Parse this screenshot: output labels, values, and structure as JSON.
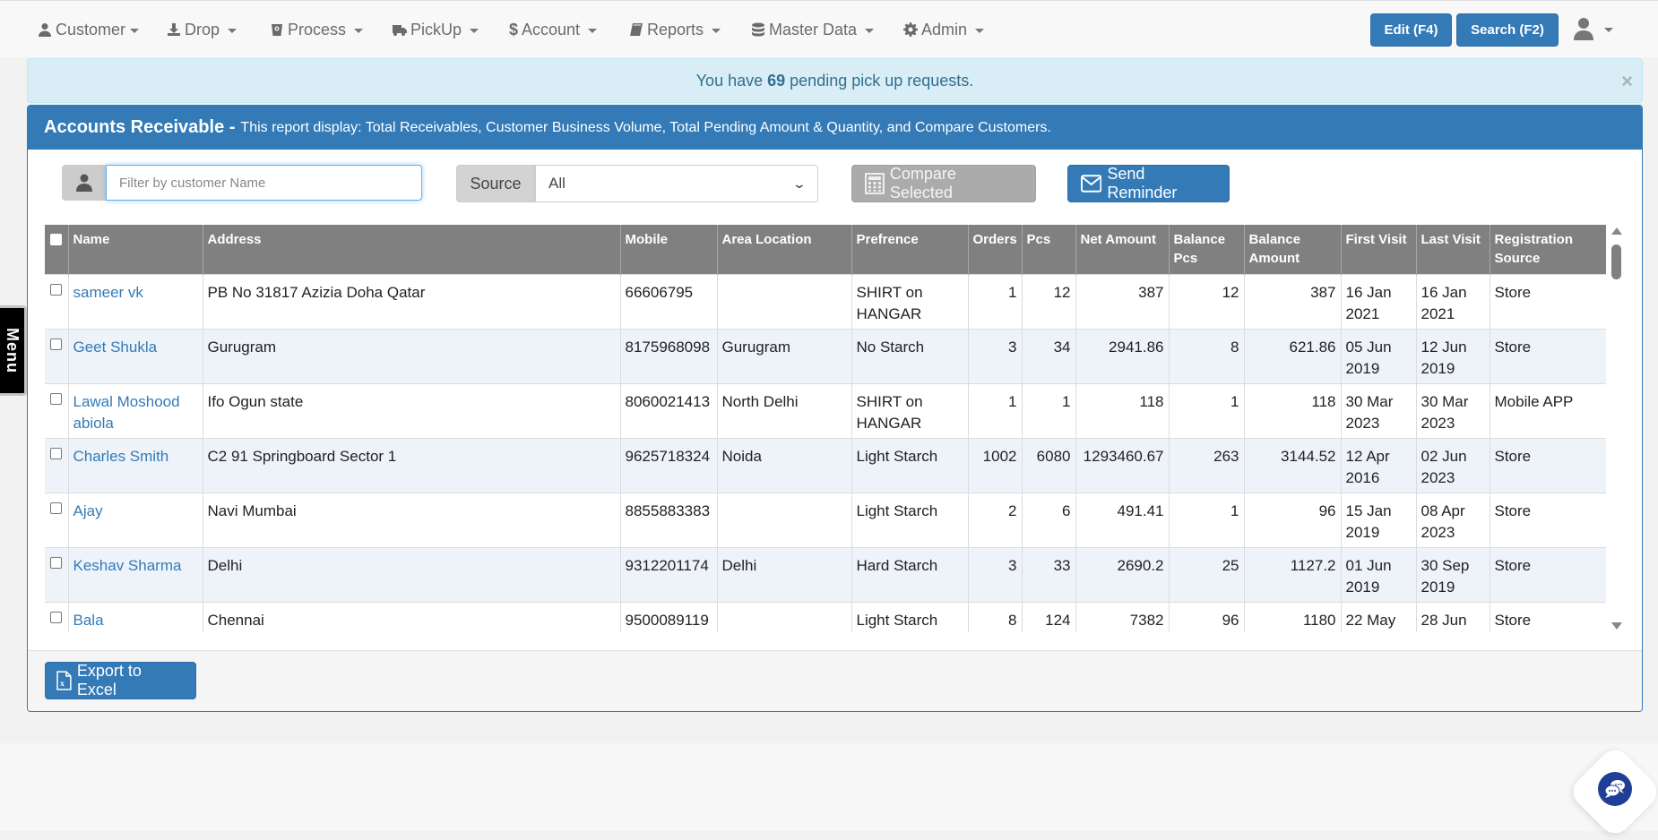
{
  "nav": {
    "items": [
      {
        "label": "Customer",
        "icon": "user-icon"
      },
      {
        "label": "Drop",
        "icon": "download-icon"
      },
      {
        "label": "Process",
        "icon": "bucket-icon"
      },
      {
        "label": "PickUp",
        "icon": "truck-icon"
      },
      {
        "label": "Account",
        "icon": "dollar-icon"
      },
      {
        "label": "Reports",
        "icon": "book-icon"
      },
      {
        "label": "Master Data",
        "icon": "database-icon"
      },
      {
        "label": "Admin",
        "icon": "gear-icon"
      }
    ],
    "edit_button": "Edit (F4)",
    "search_button": "Search (F2)"
  },
  "alert": {
    "prefix": "You have",
    "count": "69",
    "suffix": "pending pick up requests.",
    "close": "×"
  },
  "panel": {
    "title": "Accounts Receivable -",
    "description": "This report display: Total Receivables, Customer Business Volume, Total Pending Amount & Quantity, and Compare Customers."
  },
  "filters": {
    "customer_placeholder": "Filter by customer Name",
    "customer_value": "",
    "source_label": "Source",
    "source_value": "All",
    "compare_button": "Compare Selected",
    "reminder_button": "Send Reminder"
  },
  "table": {
    "headers": [
      "Name",
      "Address",
      "Mobile",
      "Area Location",
      "Prefrence",
      "Orders",
      "Pcs",
      "Net Amount",
      "Balance Pcs",
      "Balance Amount",
      "First Visit",
      "Last Visit",
      "Registration Source"
    ],
    "rows": [
      {
        "name": "sameer vk",
        "address": "PB No 31817 Azizia Doha Qatar",
        "mobile": "66606795",
        "area": "",
        "preference": "SHIRT on HANGAR",
        "orders": "1",
        "pcs": "12",
        "net_amount": "387",
        "balance_pcs": "12",
        "balance_amount": "387",
        "first_visit": "16 Jan 2021",
        "last_visit": "16 Jan 2021",
        "source": "Store"
      },
      {
        "name": "Geet Shukla",
        "address": "Gurugram",
        "mobile": "8175968098",
        "area": "Gurugram",
        "preference": "No Starch",
        "orders": "3",
        "pcs": "34",
        "net_amount": "2941.86",
        "balance_pcs": "8",
        "balance_amount": "621.86",
        "first_visit": "05 Jun 2019",
        "last_visit": "12 Jun 2019",
        "source": "Store"
      },
      {
        "name": "Lawal Moshood abiola",
        "address": "Ifo Ogun state",
        "mobile": "8060021413",
        "area": "North Delhi",
        "preference": "SHIRT on HANGAR",
        "orders": "1",
        "pcs": "1",
        "net_amount": "118",
        "balance_pcs": "1",
        "balance_amount": "118",
        "first_visit": "30 Mar 2023",
        "last_visit": "30 Mar 2023",
        "source": "Mobile APP"
      },
      {
        "name": "Charles Smith",
        "address": "C2 91 Springboard Sector 1",
        "mobile": "9625718324",
        "area": "Noida",
        "preference": "Light Starch",
        "orders": "1002",
        "pcs": "6080",
        "net_amount": "1293460.67",
        "balance_pcs": "263",
        "balance_amount": "3144.52",
        "first_visit": "12 Apr 2016",
        "last_visit": "02 Jun 2023",
        "source": "Store"
      },
      {
        "name": "Ajay",
        "address": "Navi Mumbai",
        "mobile": "8855883383",
        "area": "",
        "preference": "Light Starch",
        "orders": "2",
        "pcs": "6",
        "net_amount": "491.41",
        "balance_pcs": "1",
        "balance_amount": "96",
        "first_visit": "15 Jan 2019",
        "last_visit": "08 Apr 2023",
        "source": "Store"
      },
      {
        "name": "Keshav Sharma",
        "address": "Delhi",
        "mobile": "9312201174",
        "area": "Delhi",
        "preference": "Hard Starch",
        "orders": "3",
        "pcs": "33",
        "net_amount": "2690.2",
        "balance_pcs": "25",
        "balance_amount": "1127.2",
        "first_visit": "01 Jun 2019",
        "last_visit": "30 Sep 2019",
        "source": "Store"
      },
      {
        "name": "Bala",
        "address": "Chennai",
        "mobile": "9500089119",
        "area": "",
        "preference": "Light Starch",
        "orders": "8",
        "pcs": "124",
        "net_amount": "7382",
        "balance_pcs": "96",
        "balance_amount": "1180",
        "first_visit": "22 May",
        "last_visit": "28 Jun",
        "source": "Store"
      }
    ]
  },
  "footer": {
    "export_button": "Export to Excel"
  },
  "side_menu": {
    "label": "Menu"
  },
  "colors": {
    "primary": "#337ab7",
    "alert_bg": "#d9edf7",
    "alert_text": "#31708f",
    "table_header": "#808080",
    "row_alt": "#eef3fa",
    "chat_icon": "#1f3f96"
  }
}
